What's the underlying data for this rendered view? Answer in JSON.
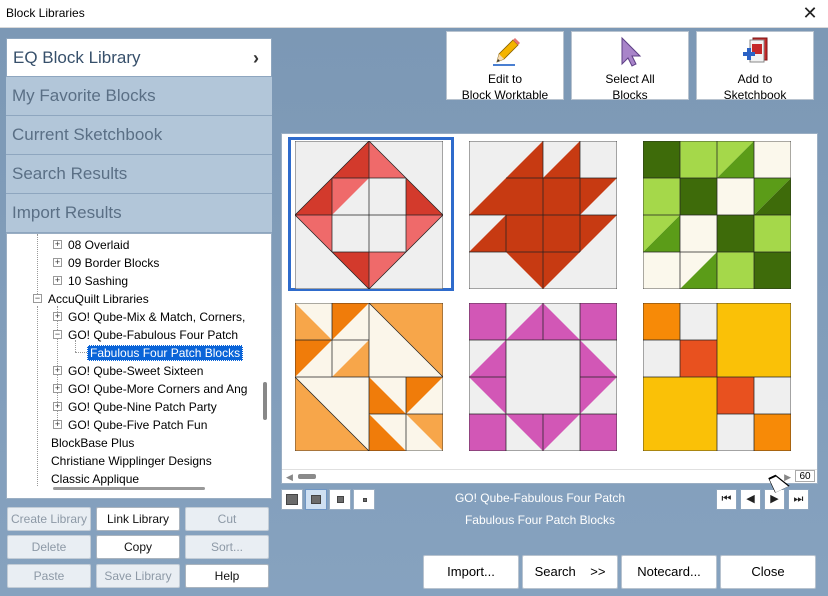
{
  "window": {
    "title": "Block Libraries",
    "close_glyph": "✕"
  },
  "library_tabs": [
    {
      "label": "EQ Block Library",
      "active": true
    },
    {
      "label": "My Favorite Blocks",
      "active": false
    },
    {
      "label": "Current Sketchbook",
      "active": false
    },
    {
      "label": "Search Results",
      "active": false
    },
    {
      "label": "Import Results",
      "active": false
    }
  ],
  "tab_chevron": "›",
  "tree": [
    {
      "label": "08 Overlaid",
      "expander": "+",
      "level": 2
    },
    {
      "label": "09 Border Blocks",
      "expander": "+",
      "level": 2
    },
    {
      "label": "10 Sashing",
      "expander": "+",
      "level": 2
    },
    {
      "label": "AccuQuilt Libraries",
      "expander": "−",
      "level": 1
    },
    {
      "label": "GO! Qube-Mix & Match, Corners,",
      "expander": "+",
      "level": 2
    },
    {
      "label": "GO! Qube-Fabulous Four Patch",
      "expander": "−",
      "level": 2
    },
    {
      "label": "Fabulous Four Patch Blocks",
      "expander": "",
      "level": 3,
      "selected": true
    },
    {
      "label": "GO! Qube-Sweet Sixteen",
      "expander": "+",
      "level": 2
    },
    {
      "label": "GO! Qube-More Corners and Ang",
      "expander": "+",
      "level": 2
    },
    {
      "label": "GO! Qube-Nine Patch Party",
      "expander": "+",
      "level": 2
    },
    {
      "label": "GO! Qube-Five Patch Fun",
      "expander": "+",
      "level": 2
    },
    {
      "label": "BlockBase Plus",
      "expander": "",
      "level": 1
    },
    {
      "label": "Christiane Wipplinger Designs",
      "expander": "",
      "level": 1
    },
    {
      "label": "Classic Applique",
      "expander": "",
      "level": 1
    }
  ],
  "library_buttons": [
    {
      "label": "Create Library",
      "enabled": false
    },
    {
      "label": "Link Library",
      "enabled": true
    },
    {
      "label": "Cut",
      "enabled": false
    },
    {
      "label": "Delete",
      "enabled": false
    },
    {
      "label": "Copy",
      "enabled": true
    },
    {
      "label": "Sort...",
      "enabled": false
    },
    {
      "label": "Paste",
      "enabled": false
    },
    {
      "label": "Save Library",
      "enabled": false
    },
    {
      "label": "Help",
      "enabled": true
    }
  ],
  "toolbar": {
    "edit": {
      "line1": "Edit to",
      "line2": "Block Worktable",
      "icon": "pencil-icon"
    },
    "select_all": {
      "line1": "Select All",
      "line2": "Blocks",
      "icon": "cursor-arrow-icon"
    },
    "add": {
      "line1": "Add to",
      "line2": "Sketchbook",
      "icon": "sketchbook-add-icon"
    }
  },
  "block_count": "60",
  "caption": {
    "library": "GO! Qube-Fabulous Four Patch",
    "book": "Fabulous Four Patch Blocks"
  },
  "nav": {
    "first": "⏮",
    "prev": "◀",
    "next": "▶",
    "last": "⏭"
  },
  "bottom_buttons": {
    "import": "Import...",
    "search": "Search",
    "search_arrows": ">>",
    "notecard": "Notecard...",
    "close": "Close"
  },
  "colors": {
    "accent": "#2e6bcc",
    "panel_bg": "#7f9bb7",
    "selection": "#0a64d8"
  }
}
